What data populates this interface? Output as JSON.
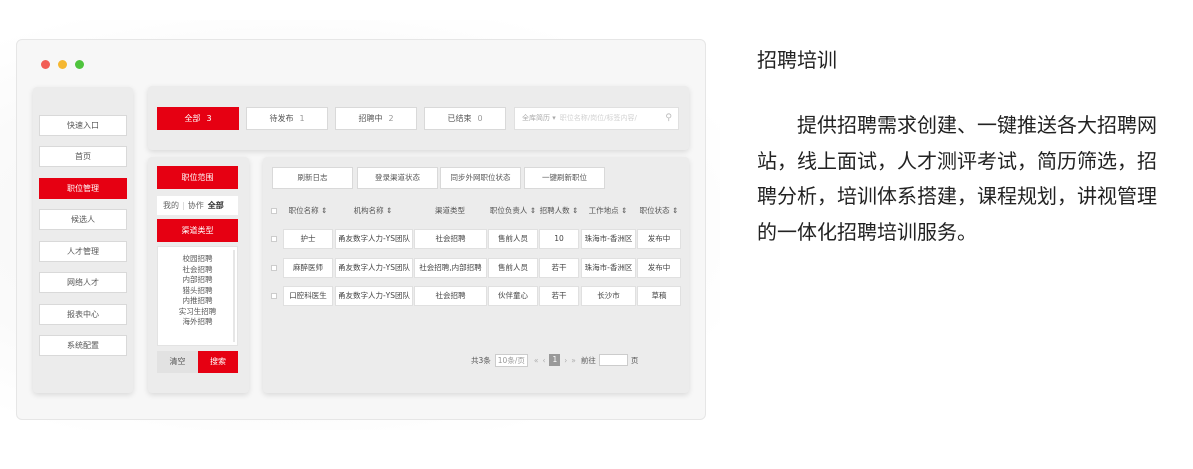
{
  "colors": {
    "brand_red": "#e60012",
    "dot_red": "#f25e56",
    "dot_yellow": "#f5b731",
    "dot_green": "#4fc43d"
  },
  "sidebar": {
    "items": [
      {
        "label": "快速入口",
        "active": false
      },
      {
        "label": "首页",
        "active": false
      },
      {
        "label": "职位管理",
        "active": true
      },
      {
        "label": "候选人",
        "active": false
      },
      {
        "label": "人才管理",
        "active": false
      },
      {
        "label": "网络人才",
        "active": false
      },
      {
        "label": "报表中心",
        "active": false
      },
      {
        "label": "系统配置",
        "active": false
      }
    ]
  },
  "filter": {
    "tabs": [
      {
        "label": "全部",
        "count": "3",
        "active": true
      },
      {
        "label": "待发布",
        "count": "1",
        "active": false
      },
      {
        "label": "招聘中",
        "count": "2",
        "active": false
      },
      {
        "label": "已结束",
        "count": "0",
        "active": false
      }
    ],
    "search_select": "全库简历 ▾",
    "search_placeholder": "职位名称/岗位/标签内容/",
    "search_icon": "search-icon"
  },
  "left_panel": {
    "scope_title": "职位范围",
    "scope_mine": "我的",
    "scope_coop": "协作",
    "scope_all": "全部",
    "channel_title": "渠道类型",
    "channels": [
      "校园招聘",
      "社会招聘",
      "内部招聘",
      "猎头招聘",
      "内推招聘",
      "实习生招聘",
      "海外招聘"
    ],
    "clear_label": "清空",
    "search_label": "搜索"
  },
  "toolbar": {
    "buttons": [
      "刷新日志",
      "登录渠道状态",
      "同步外网职位状态",
      "一键刷新职位"
    ]
  },
  "table": {
    "headers": [
      "职位名称 ⇕",
      "机构名称 ⇕",
      "渠道类型",
      "职位负责人 ⇕",
      "招聘人数 ⇕",
      "工作地点 ⇕",
      "职位状态 ⇕"
    ],
    "rows": [
      [
        "护士",
        "甬友数字人力-YS团队",
        "社会招聘",
        "售前人员",
        "10",
        "珠海市-香洲区",
        "发布中"
      ],
      [
        "麻醉医师",
        "甬友数字人力-YS团队",
        "社会招聘,内部招聘",
        "售前人员",
        "若干",
        "珠海市-香洲区",
        "发布中"
      ],
      [
        "口腔科医生",
        "甬友数字人力-YS团队",
        "社会招聘",
        "伙伴童心",
        "若干",
        "长沙市",
        "草稿"
      ]
    ]
  },
  "pagination": {
    "total": "共3条",
    "page_size": "10条/页",
    "prev": "«",
    "prev2": "‹",
    "current": "1",
    "next": "›",
    "next2": "»",
    "goto": "前往",
    "page_unit": "页"
  },
  "right": {
    "title": "招聘培训",
    "description": "提供招聘需求创建、一键推送各大招聘网站，线上面试，人才测评考试，简历筛选，招聘分析，培训体系搭建，课程规划，讲视管理的一体化招聘培训服务。"
  }
}
